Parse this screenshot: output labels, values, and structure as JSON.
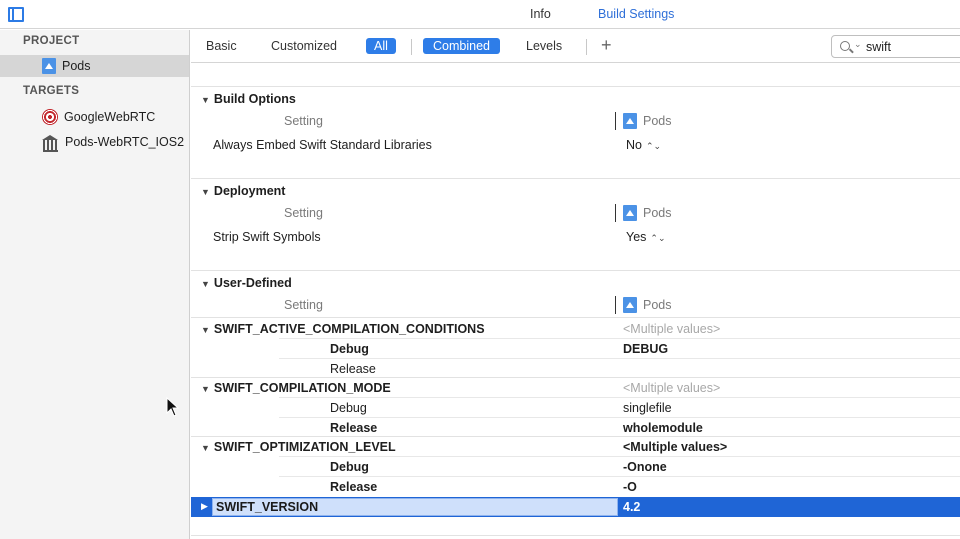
{
  "tabs": {
    "info": "Info",
    "build_settings": "Build Settings"
  },
  "sidebar": {
    "project_header": "PROJECT",
    "project_item": "Pods",
    "targets_header": "TARGETS",
    "targets": [
      "GoogleWebRTC",
      "Pods-WebRTC_IOS2"
    ]
  },
  "filter": {
    "basic": "Basic",
    "customized": "Customized",
    "all": "All",
    "combined": "Combined",
    "levels": "Levels",
    "add": "+",
    "search_value": "swift"
  },
  "column": {
    "setting": "Setting",
    "target": "Pods"
  },
  "sections": {
    "build_options": {
      "title": "Build Options",
      "rows": [
        {
          "name": "Always Embed Swift Standard Libraries",
          "value": "No"
        }
      ]
    },
    "deployment": {
      "title": "Deployment",
      "rows": [
        {
          "name": "Strip Swift Symbols",
          "value": "Yes"
        }
      ]
    },
    "user_defined": {
      "title": "User-Defined",
      "groups": [
        {
          "name": "SWIFT_ACTIVE_COMPILATION_CONDITIONS",
          "value": "<Multiple values>",
          "configs": [
            {
              "name": "Debug",
              "value": "DEBUG"
            },
            {
              "name": "Release",
              "value": ""
            }
          ]
        },
        {
          "name": "SWIFT_COMPILATION_MODE",
          "value": "<Multiple values>",
          "configs": [
            {
              "name": "Debug",
              "value": "singlefile"
            },
            {
              "name": "Release",
              "value": "wholemodule"
            }
          ]
        },
        {
          "name": "SWIFT_OPTIMIZATION_LEVEL",
          "value": "<Multiple values>",
          "configs": [
            {
              "name": "Debug",
              "value": "-Onone"
            },
            {
              "name": "Release",
              "value": "-O"
            }
          ]
        }
      ],
      "selected": {
        "name": "SWIFT_VERSION",
        "value": "4.2"
      }
    }
  },
  "colors": {
    "accent": "#2e7de8",
    "selection": "#1f65d6"
  }
}
